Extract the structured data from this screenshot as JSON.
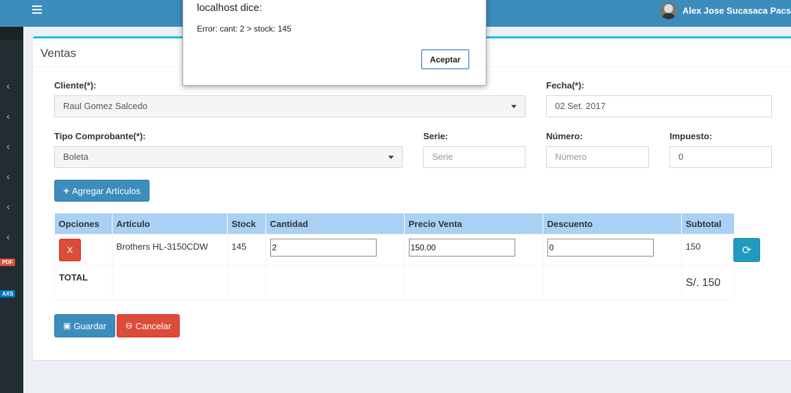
{
  "header": {
    "user_name": "Alex Jose Sucasaca Pacs"
  },
  "sidebar": {
    "pdf_badge": "PDF",
    "axs_badge": "AXS"
  },
  "box": {
    "title": "Ventas"
  },
  "form": {
    "cliente_label": "Cliente(*):",
    "cliente_value": "Raul Gomez Salcedo",
    "fecha_label": "Fecha(*):",
    "fecha_value": "02 Set. 2017",
    "tipo_label": "Tipo Comprobante(*):",
    "tipo_value": "Boleta",
    "serie_label": "Serie:",
    "serie_placeholder": "Serie",
    "numero_label": "Número:",
    "numero_placeholder": "Número",
    "impuesto_label": "Impuesto:",
    "impuesto_value": "0",
    "add_button": "Agregar Artículos"
  },
  "table": {
    "headers": [
      "Opciones",
      "Artículo",
      "Stock",
      "Cantidad",
      "Precio Venta",
      "Descuento",
      "Subtotal"
    ],
    "row": {
      "delete_label": "X",
      "articulo": "Brothers HL-3150CDW",
      "stock": "145",
      "cantidad": "2",
      "precio": "150.00",
      "descuento": "0",
      "subtotal": "150"
    },
    "total_label": "TOTAL",
    "total_value": "S/. 150"
  },
  "actions": {
    "save": "Guardar",
    "cancel": "Cancelar"
  },
  "dialog": {
    "title": "localhost dice:",
    "message": "Error: cant: 2 > stock: 145",
    "ok": "Aceptar"
  },
  "colors": {
    "topbar": "#3c8dbc",
    "sidebar": "#222d32",
    "table_header": "#a9d0f5",
    "primary": "#3c8dbc",
    "danger": "#dd4b39"
  }
}
